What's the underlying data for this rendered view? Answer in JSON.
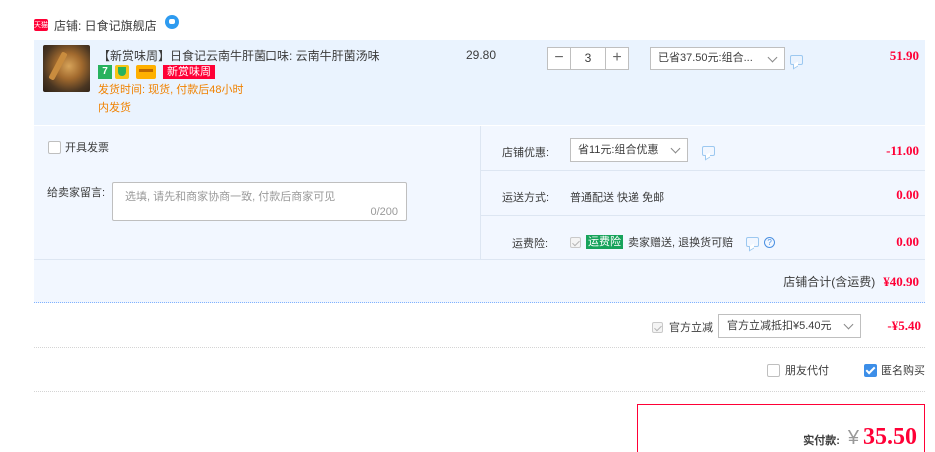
{
  "shop": {
    "icon": "天猫",
    "label": "店铺: 日食记旗舰店"
  },
  "item": {
    "title": "【新赏味周】日食记云南牛肝菌...",
    "flavor": "口味: 云南牛肝菌汤味",
    "badge_seven": "7",
    "badge_new": "新赏味周",
    "shipping_lines": [
      "发货时间: 现货, 付款后48小时",
      "内发货"
    ],
    "unit_price": "29.80",
    "quantity": "3",
    "qty_minus": "−",
    "qty_plus": "+",
    "promo_select": "已省37.50元:组合...",
    "total": "51.90"
  },
  "invoice": {
    "label": "开具发票"
  },
  "message": {
    "label": "给卖家留言:",
    "placeholder": "选填, 请先和商家协商一致, 付款后商家可见",
    "count": "0/200"
  },
  "shop_discount": {
    "label": "店铺优惠:",
    "selected": "省11元:组合优惠",
    "amount": "-11.00"
  },
  "delivery": {
    "label": "运送方式:",
    "value": "普通配送 快递 免邮",
    "amount": "0.00"
  },
  "insurance": {
    "label": "运费险:",
    "badge": "运费险",
    "text": "卖家赠送, 退换货可赔",
    "amount": "0.00"
  },
  "shop_total": {
    "label": "店铺合计(含运费)",
    "amount": "¥40.90"
  },
  "official": {
    "label": "官方立减",
    "selected": "官方立减抵扣¥5.40元",
    "amount": "-¥5.40"
  },
  "options": {
    "friend_pay": "朋友代付",
    "anonymous": "匿名购买"
  },
  "payment": {
    "label": "实付款:",
    "currency": "¥",
    "amount": "35.50"
  },
  "colors": {
    "accent_red": "#ff0036",
    "item_bg": "#eaf3fe",
    "form_bg": "#f2f7ff",
    "ship_orange": "#f08200"
  }
}
